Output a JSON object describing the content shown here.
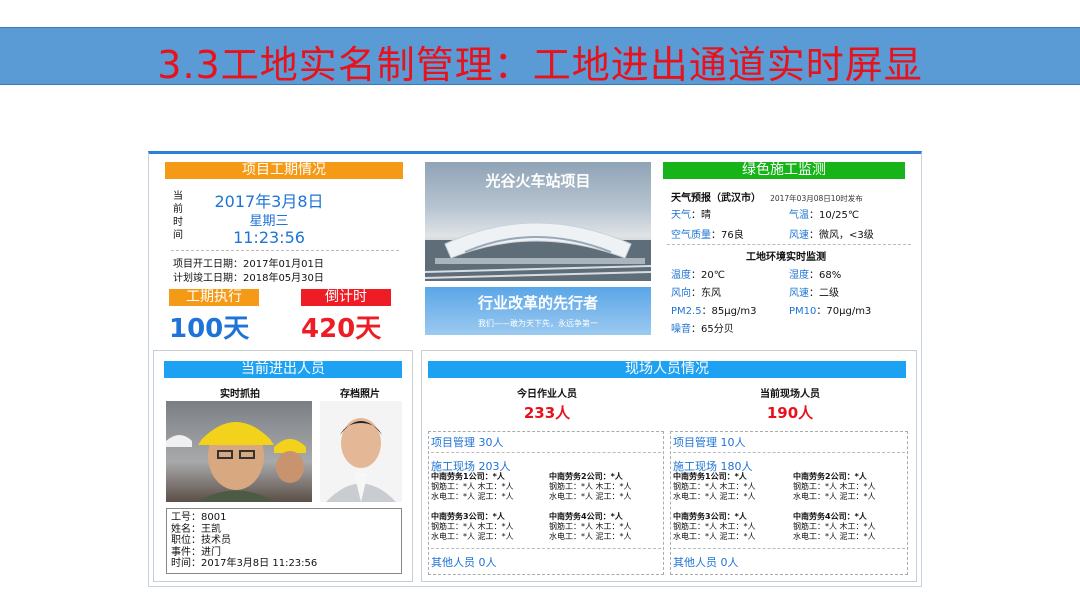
{
  "slide": {
    "title": "3.3工地实名制管理：工地进出通道实时屏显"
  },
  "schedule": {
    "header": "项目工期情况",
    "date_label": [
      "当",
      "前",
      "时",
      "间"
    ],
    "date": "2017年3月8日",
    "weekday": "星期三",
    "time": "11:23:56",
    "start_date": "项目开工日期：2017年01月01日",
    "finish_date": "计划竣工日期：2018年05月30日",
    "executed_label": "工期执行",
    "executed_value": "100天",
    "countdown_label": "倒计时",
    "countdown_value": "420天"
  },
  "project": {
    "name": "光谷火车站项目",
    "slogan": "行业改革的先行者",
    "motto": "我们——敢为天下先，永远争第一"
  },
  "green": {
    "header": "绿色施工监测",
    "forecast_title": "天气预报（武汉市）",
    "forecast_time": "2017年03月08日10时发布",
    "weather_label": "天气",
    "weather_value": "：晴",
    "temp_label": "气温",
    "temp_value": "：10/25℃",
    "air_label": "空气质量",
    "air_value": "：76良",
    "wind_label": "风速",
    "wind_value": "：微风，<3级",
    "env_title": "工地环境实时监测",
    "env_temp_label": "温度",
    "env_temp_value": "：20℃",
    "env_hum_label": "湿度",
    "env_hum_value": "：68%",
    "env_dir_label": "风向",
    "env_dir_value": "：东风",
    "env_speed_label": "风速",
    "env_speed_value": "：二级",
    "pm25_label": "PM2.5",
    "pm25_value": "：85μg/m3",
    "pm10_label": "PM10",
    "pm10_value": "：70μg/m3",
    "noise_label": "噪音",
    "noise_value": "：65分贝"
  },
  "access": {
    "header": "当前进出人员",
    "live_label": "实时抓拍",
    "archive_label": "存档照片",
    "info": [
      "工号：8001",
      "姓名：王凯",
      "职位：技术员",
      "事件：进门",
      "时间：2017年3月8日 11:23:56"
    ]
  },
  "site": {
    "header": "现场人员情况",
    "today_label": "今日作业人员",
    "today_value": "233人",
    "current_label": "当前现场人员",
    "current_value": "190人",
    "left": {
      "mgmt": "项目管理   30人",
      "construction": "施工现场   203人",
      "others": "其他人员     0人"
    },
    "right": {
      "mgmt": "项目管理    10人",
      "construction": "施工现场   180人",
      "others": "其他人员     0人"
    },
    "companies": [
      "中南劳务1公司：*人",
      "中南劳务2公司：*人",
      "中南劳务3公司：*人",
      "中南劳务4公司：*人"
    ],
    "line1": "钢筋工：*人  木工：*人",
    "line2": "水电工：*人  泥工：*人"
  },
  "colors": {
    "title_bar": "#5b9bd5",
    "title_text": "#e8121c",
    "orange": "#f59a16",
    "green": "#16b418",
    "blue": "#1da1f2",
    "red": "#ee1c25",
    "value_blue": "#1e73d6"
  }
}
